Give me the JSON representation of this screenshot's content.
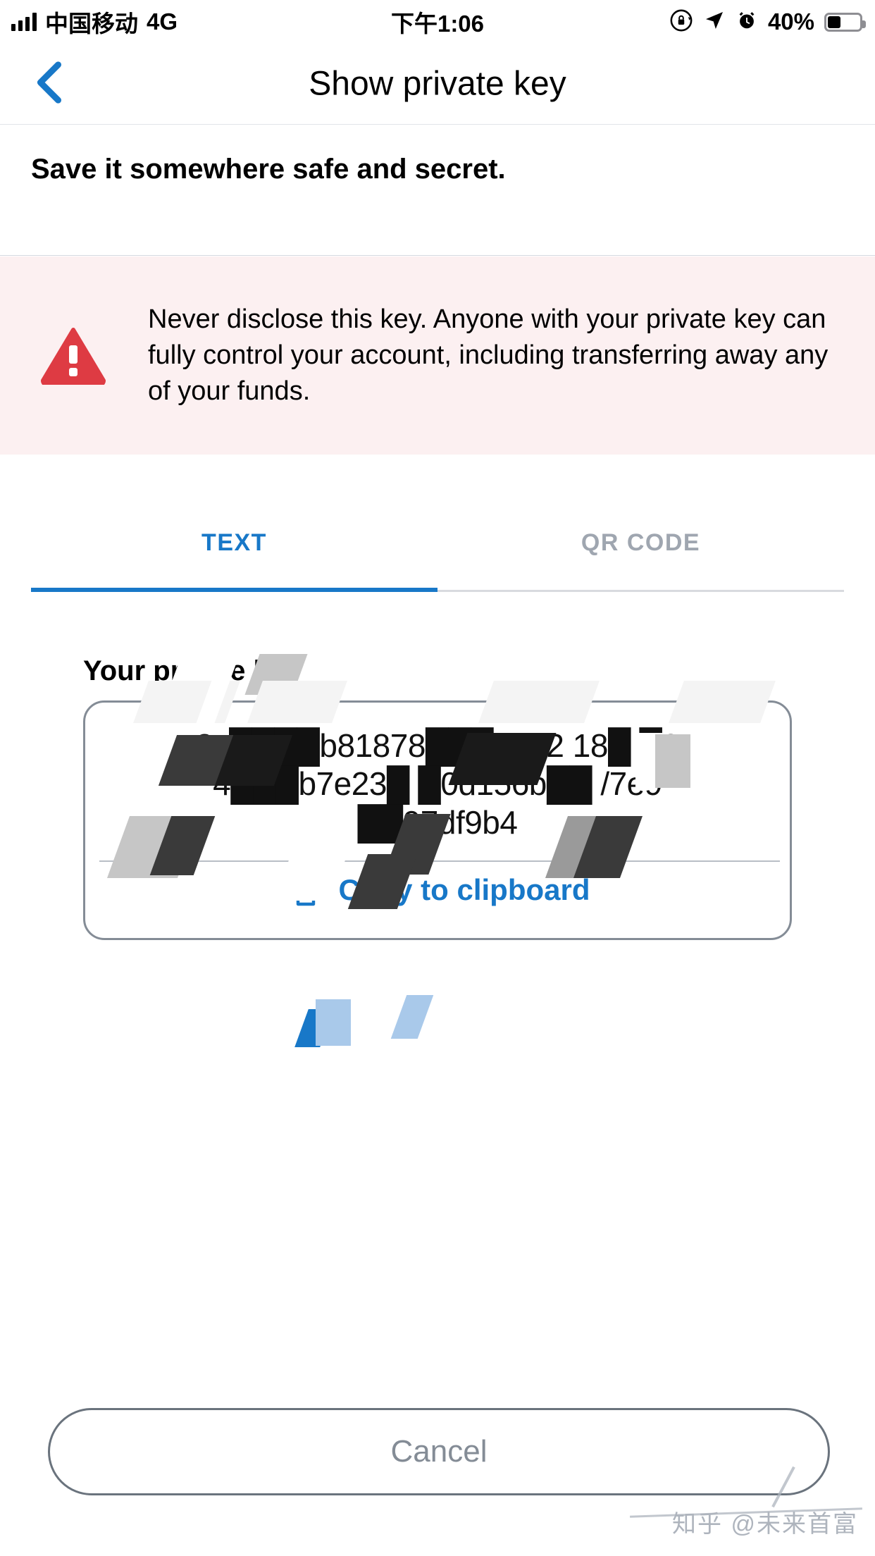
{
  "statusbar": {
    "carrier": "中国移动",
    "network": "4G",
    "time": "下午1:06",
    "battery_percent": "40%",
    "icons": [
      "signal-bars-icon",
      "rotation-lock-icon",
      "location-arrow-icon",
      "alarm-clock-icon",
      "battery-icon"
    ]
  },
  "navbar": {
    "title": "Show private key",
    "back_icon": "chevron-left-icon",
    "back_color": "#1878c8"
  },
  "subtitle": "Save it somewhere safe and secret.",
  "warning": {
    "icon": "warning-triangle-icon",
    "icon_color": "#de3b43",
    "background": "#fcf0f1",
    "text": "Never disclose this key. Anyone with your private key can fully control your account, including transferring away any of your funds."
  },
  "tabs": [
    {
      "label": "TEXT",
      "active": true,
      "color": "#1878c8"
    },
    {
      "label": "QR CODE",
      "active": false,
      "color": "#9fa6b0"
    }
  ],
  "key_section": {
    "label": "Your private key",
    "value_line1": "8c████b81878███8082 18█ █3",
    "value_line2": "4███b7e23█ █0d156b██ /7e9",
    "value_line3": "██97df9b4",
    "copy_label": "Copy to clipboard",
    "copy_icon": "copy-documents-icon",
    "copy_color": "#1878c8",
    "redacted": true
  },
  "cancel": {
    "label": "Cancel",
    "border_color": "#6a737d",
    "text_color": "#848c96"
  },
  "watermark": "知乎 @未来首富"
}
